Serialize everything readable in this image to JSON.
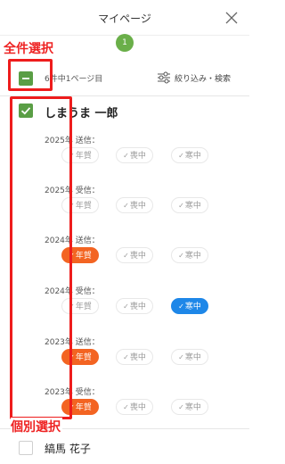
{
  "header": {
    "title": "マイページ",
    "page_badge": "1"
  },
  "annotations": {
    "select_all": "全件選択",
    "select_individual": "個別選択"
  },
  "toolbar": {
    "page_info": "6件中1ページ目",
    "filter_label": "絞り込み・検索"
  },
  "contacts": [
    {
      "name": "しまうま 一郎",
      "checked": true,
      "rows": [
        {
          "label": "2025年 送信：",
          "chips": [
            {
              "text": "年賀",
              "state": "off"
            },
            {
              "text": "喪中",
              "state": "off"
            },
            {
              "text": "寒中",
              "state": "off"
            }
          ]
        },
        {
          "label": "2025年 受信：",
          "chips": [
            {
              "text": "年賀",
              "state": "off"
            },
            {
              "text": "喪中",
              "state": "off"
            },
            {
              "text": "寒中",
              "state": "off"
            }
          ]
        },
        {
          "label": "2024年 送信：",
          "chips": [
            {
              "text": "年賀",
              "state": "red"
            },
            {
              "text": "喪中",
              "state": "off"
            },
            {
              "text": "寒中",
              "state": "off"
            }
          ]
        },
        {
          "label": "2024年 受信：",
          "chips": [
            {
              "text": "年賀",
              "state": "off"
            },
            {
              "text": "喪中",
              "state": "off"
            },
            {
              "text": "寒中",
              "state": "blue"
            }
          ]
        },
        {
          "label": "2023年 送信：",
          "chips": [
            {
              "text": "年賀",
              "state": "red"
            },
            {
              "text": "喪中",
              "state": "off"
            },
            {
              "text": "寒中",
              "state": "off"
            }
          ]
        },
        {
          "label": "2023年 受信：",
          "chips": [
            {
              "text": "年賀",
              "state": "red"
            },
            {
              "text": "喪中",
              "state": "off"
            },
            {
              "text": "寒中",
              "state": "off"
            }
          ]
        }
      ]
    },
    {
      "name": "縞馬 花子",
      "checked": false,
      "rows": []
    }
  ],
  "colors": {
    "green": "#5a9e45",
    "red_active": "#f36422",
    "blue_active": "#1e87e8",
    "annotation_red": "#ee1c1c"
  },
  "icons": {
    "close": "close-icon",
    "filter": "sliders-icon",
    "check": "check-icon"
  }
}
